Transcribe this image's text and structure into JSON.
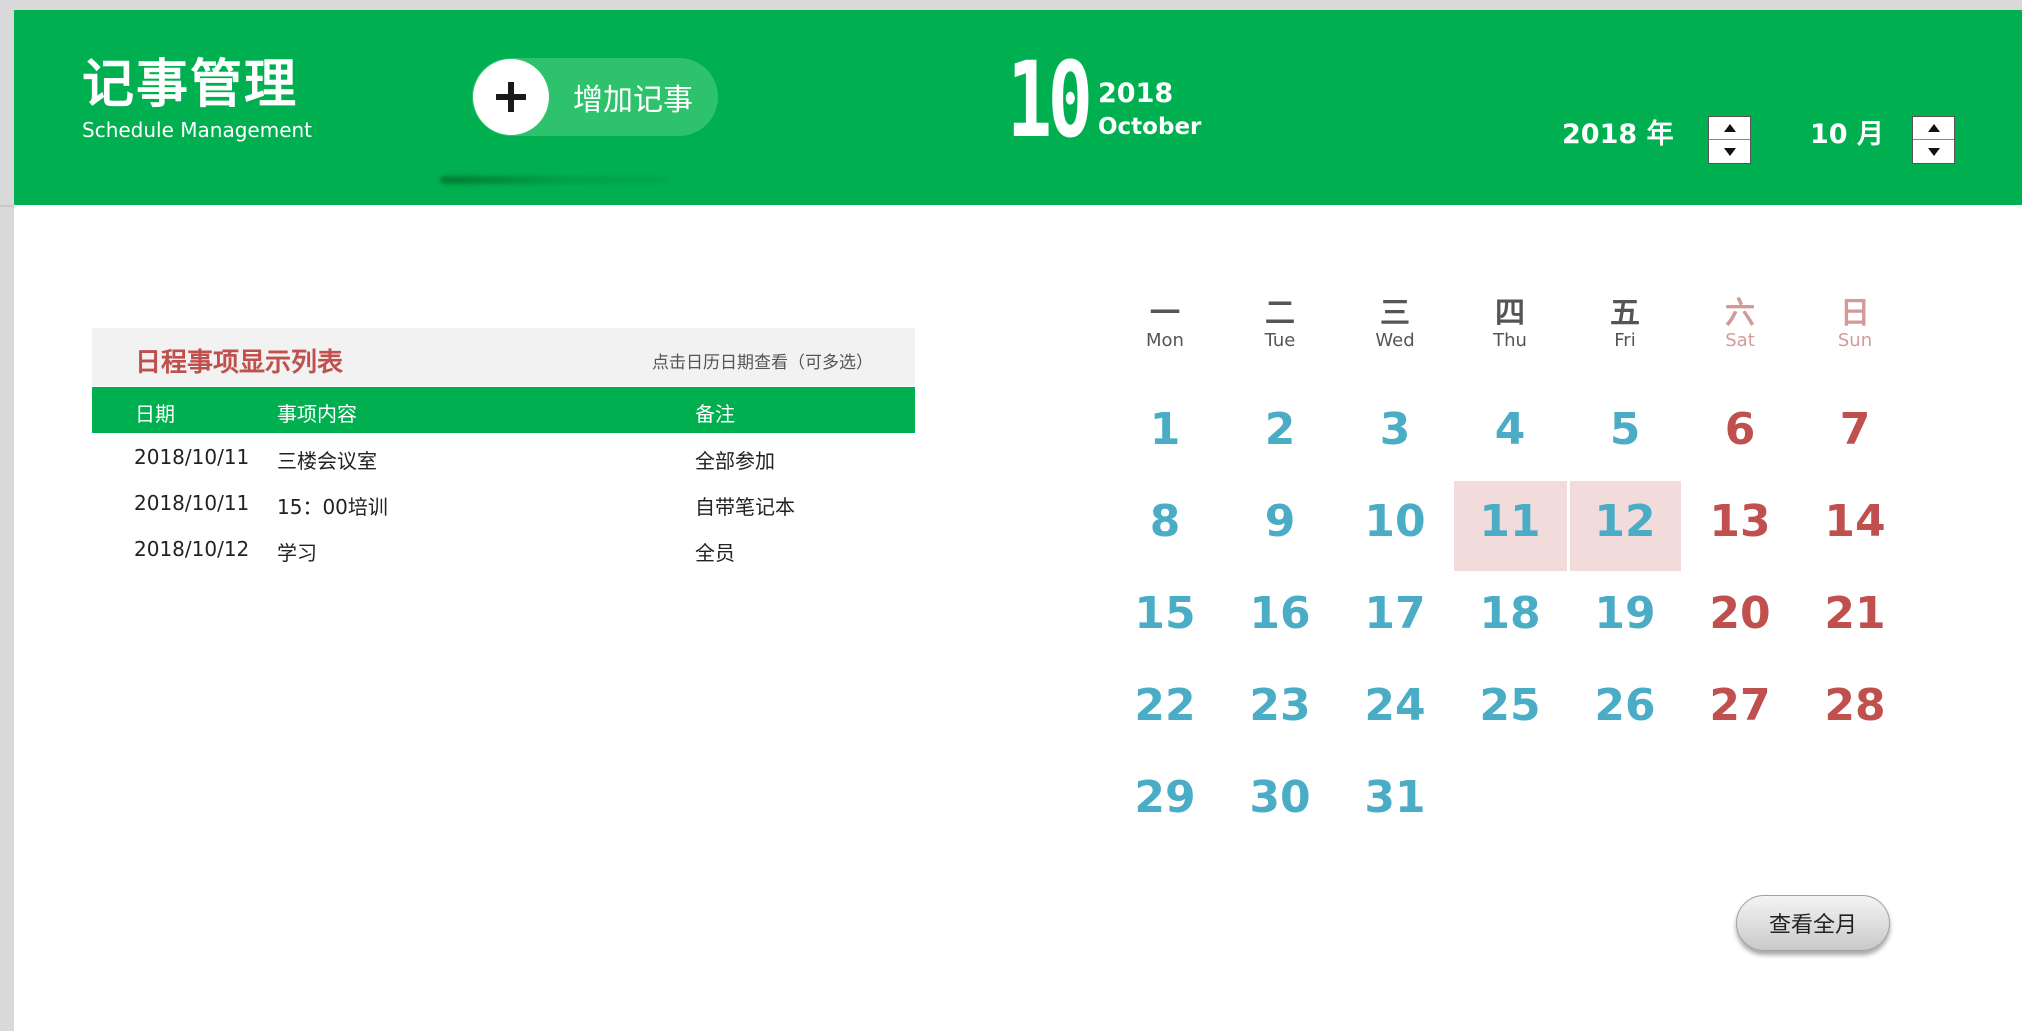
{
  "header": {
    "title": "记事管理",
    "subtitle": "Schedule Management",
    "add_button_label": "增加记事",
    "current": {
      "month_number": "10",
      "year": "2018",
      "month_name": "October"
    },
    "year_selector": {
      "value": "2018",
      "unit": "年"
    },
    "month_selector": {
      "value": "10",
      "unit": "月"
    }
  },
  "list": {
    "title": "日程事项显示列表",
    "hint": "点击日历日期查看（可多选）",
    "columns": [
      "日期",
      "事项内容",
      "备注"
    ],
    "rows": [
      [
        "2018/10/11",
        "三楼会议室",
        "全部参加"
      ],
      [
        "2018/10/11",
        "15：00培训",
        "自带笔记本"
      ],
      [
        "2018/10/12",
        "学习",
        "全员"
      ]
    ]
  },
  "calendar": {
    "weekdays_cn": [
      "一",
      "二",
      "三",
      "四",
      "五",
      "六",
      "日"
    ],
    "weekdays_en": [
      "Mon",
      "Tue",
      "Wed",
      "Thu",
      "Fri",
      "Sat",
      "Sun"
    ],
    "weeks": [
      [
        "1",
        "2",
        "3",
        "4",
        "5",
        "6",
        "7"
      ],
      [
        "8",
        "9",
        "10",
        "11",
        "12",
        "13",
        "14"
      ],
      [
        "15",
        "16",
        "17",
        "18",
        "19",
        "20",
        "21"
      ],
      [
        "22",
        "23",
        "24",
        "25",
        "26",
        "27",
        "28"
      ],
      [
        "29",
        "30",
        "31"
      ]
    ],
    "highlighted_days": [
      "11",
      "12"
    ],
    "view_month_button": "查看全月"
  },
  "colors": {
    "header_green": "#00b050",
    "weekday_number": "#4bacc6",
    "weekend_number": "#c0504d",
    "highlight": "#f2dcdb"
  },
  "icons": {
    "add": "plus-icon",
    "spin_up": "triangle-up-icon",
    "spin_down": "triangle-down-icon"
  }
}
